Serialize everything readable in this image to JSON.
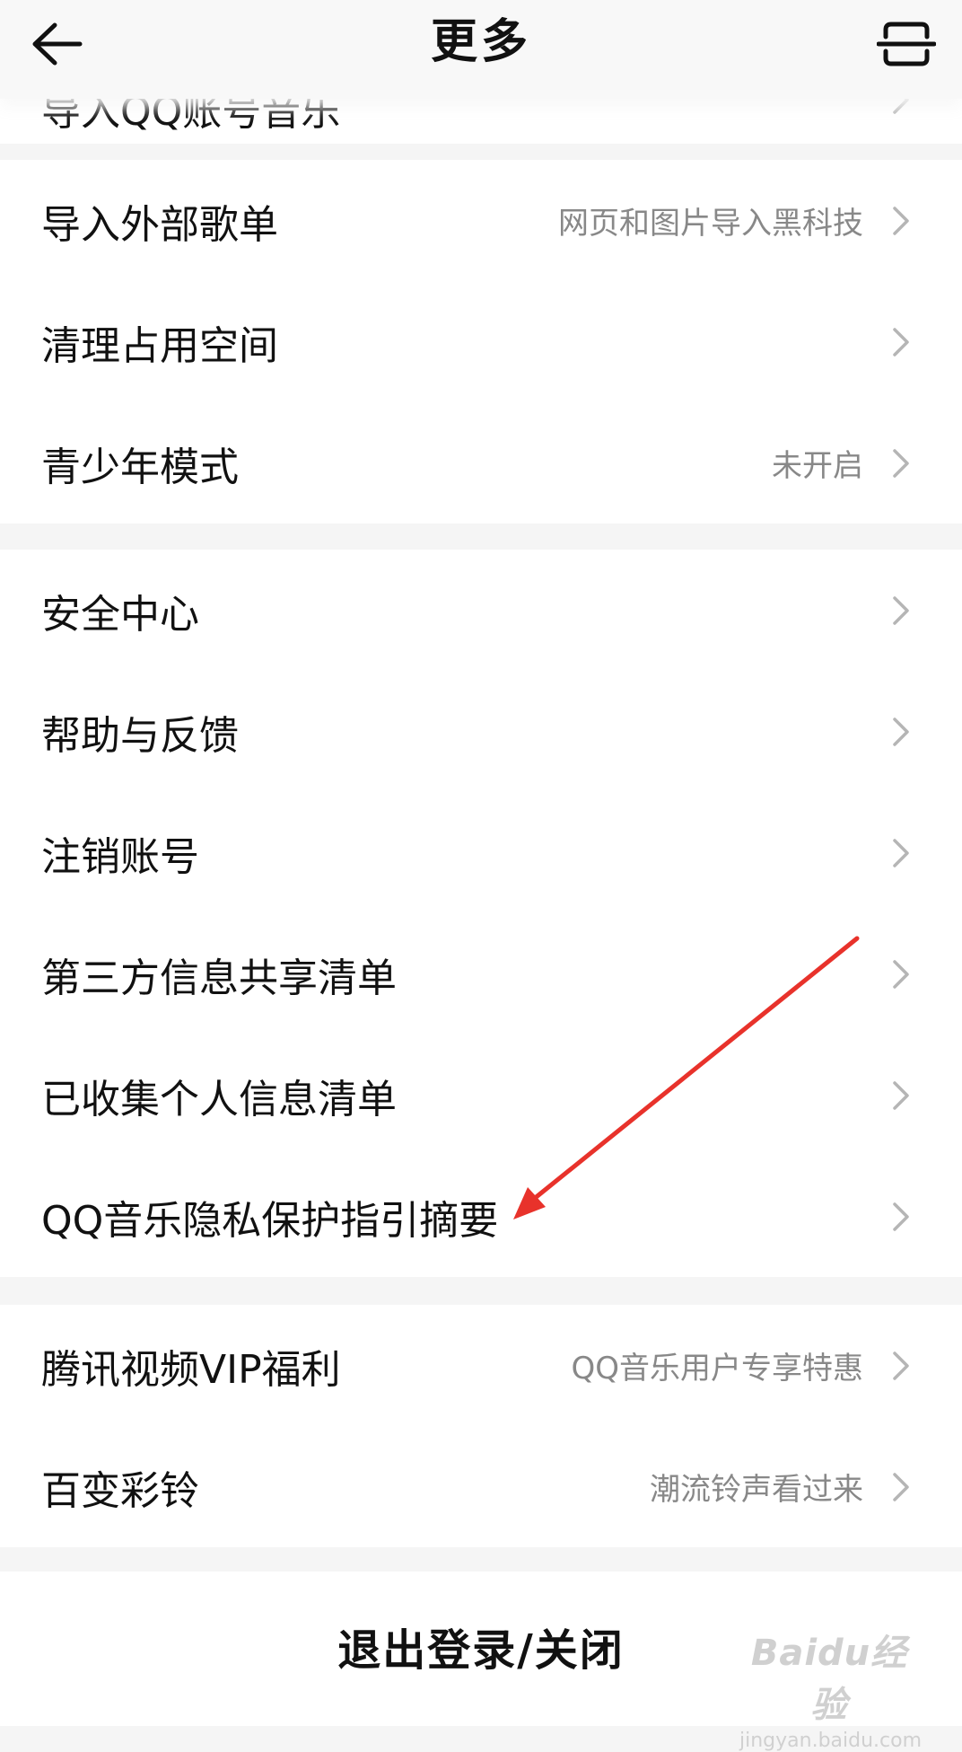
{
  "header": {
    "title": "更多"
  },
  "peek_item": {
    "label": "导入QQ账号音乐"
  },
  "groups": [
    {
      "items": [
        {
          "label": "导入外部歌单",
          "sub": "网页和图片导入黑科技"
        },
        {
          "label": "清理占用空间",
          "sub": ""
        },
        {
          "label": "青少年模式",
          "sub": "未开启"
        }
      ]
    },
    {
      "items": [
        {
          "label": "安全中心",
          "sub": ""
        },
        {
          "label": "帮助与反馈",
          "sub": ""
        },
        {
          "label": "注销账号",
          "sub": ""
        },
        {
          "label": "第三方信息共享清单",
          "sub": ""
        },
        {
          "label": "已收集个人信息清单",
          "sub": ""
        },
        {
          "label": "QQ音乐隐私保护指引摘要",
          "sub": ""
        }
      ]
    },
    {
      "items": [
        {
          "label": "腾讯视频VIP福利",
          "sub": "QQ音乐用户专享特惠"
        },
        {
          "label": "百变彩铃",
          "sub": "潮流铃声看过来"
        }
      ]
    }
  ],
  "logout": {
    "label": "退出登录/关闭"
  },
  "watermark": {
    "logo": "Baidu经验",
    "url": "jingyan.baidu.com"
  },
  "colors": {
    "annotation_arrow": "#e8322b",
    "secondary_text": "#888888",
    "chevron": "#b5b5b5"
  }
}
